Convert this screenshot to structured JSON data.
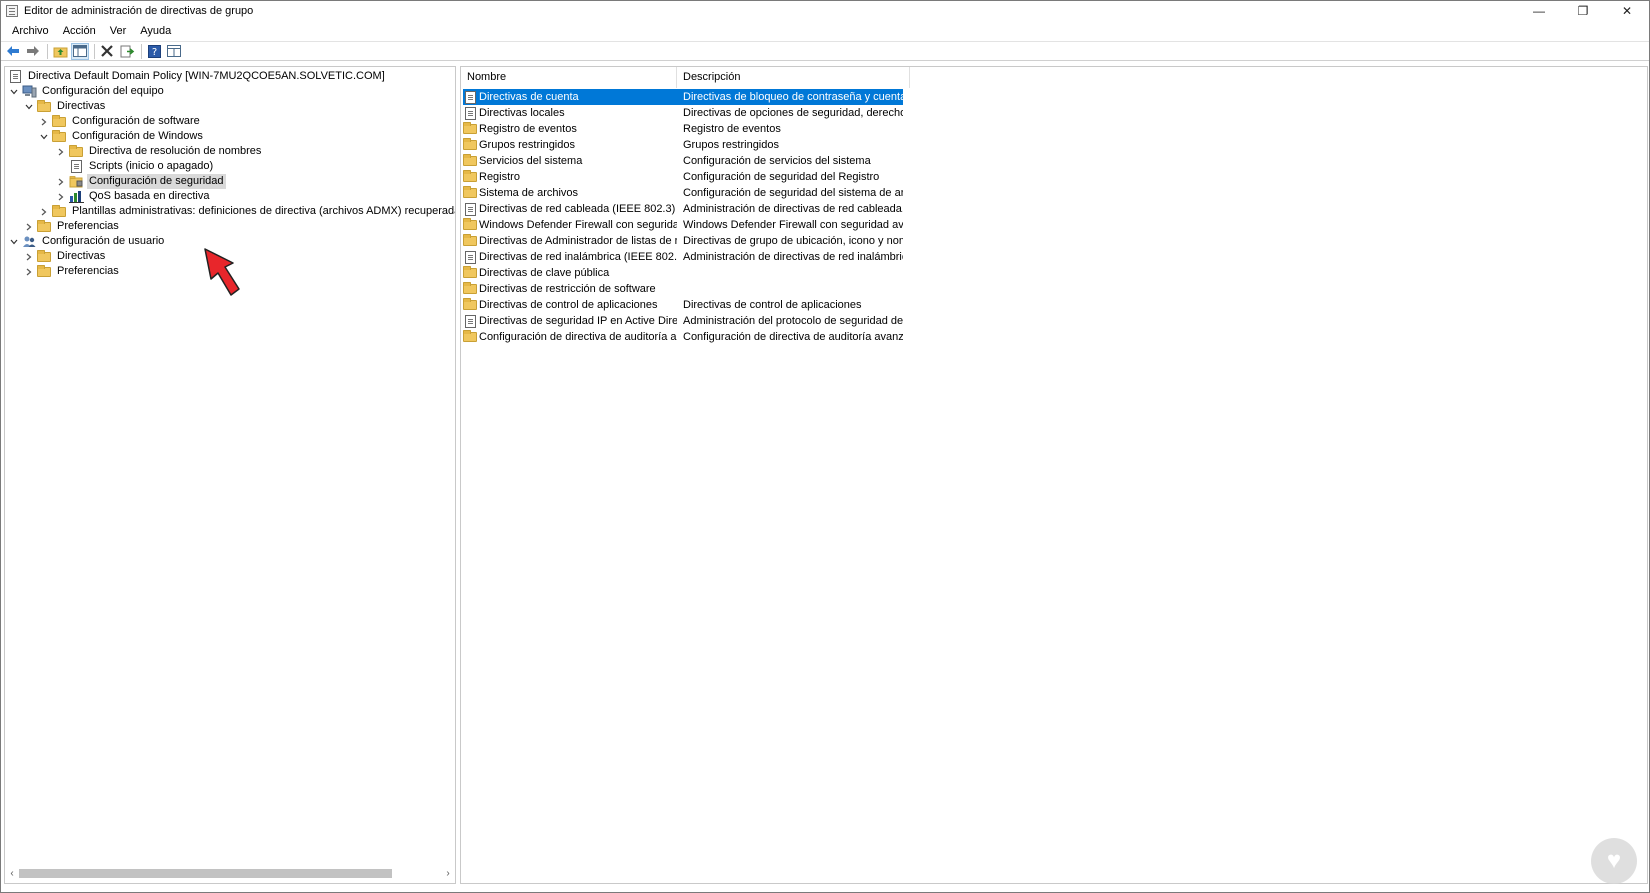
{
  "window": {
    "title": "Editor de administración de directivas de grupo",
    "controls": {
      "minimize": "—",
      "restore": "❐",
      "close": "✕"
    }
  },
  "menu": [
    "Archivo",
    "Acción",
    "Ver",
    "Ayuda"
  ],
  "toolbar": [
    "back-icon",
    "forward-icon",
    "up-folder-icon",
    "show-tree-icon",
    "delete-icon",
    "export-icon",
    "help-icon",
    "view-icon"
  ],
  "tree": {
    "root": "Directiva Default Domain Policy [WIN-7MU2QCOE5AN.SOLVETIC.COM]",
    "items": [
      {
        "label": "Configuración del equipo",
        "expander": "v"
      },
      {
        "label": "Directivas",
        "expander": "v"
      },
      {
        "label": "Configuración de software",
        "expander": ">"
      },
      {
        "label": "Configuración de Windows",
        "expander": "v"
      },
      {
        "label": "Directiva de resolución de nombres",
        "expander": ">"
      },
      {
        "label": "Scripts (inicio o apagado)",
        "expander": ""
      },
      {
        "label": "Configuración de seguridad",
        "expander": ">"
      },
      {
        "label": "QoS basada en directiva",
        "expander": ">"
      },
      {
        "label": "Plantillas administrativas: definiciones de directiva (archivos ADMX) recuperadas del",
        "expander": ">"
      },
      {
        "label": "Preferencias",
        "expander": ">"
      },
      {
        "label": "Configuración de usuario",
        "expander": "v"
      },
      {
        "label": "Directivas",
        "expander": ">"
      },
      {
        "label": "Preferencias",
        "expander": ">"
      }
    ]
  },
  "list": {
    "columns": [
      "Nombre",
      "Descripción"
    ],
    "rows": [
      {
        "name": "Directivas de cuenta",
        "desc": "Directivas de bloqueo de contraseña y cuenta"
      },
      {
        "name": "Directivas locales",
        "desc": "Directivas de opciones de seguridad, derechos ..."
      },
      {
        "name": "Registro de eventos",
        "desc": "Registro de eventos"
      },
      {
        "name": "Grupos restringidos",
        "desc": "Grupos restringidos"
      },
      {
        "name": "Servicios del sistema",
        "desc": "Configuración de servicios del sistema"
      },
      {
        "name": "Registro",
        "desc": "Configuración de seguridad del Registro"
      },
      {
        "name": "Sistema de archivos",
        "desc": "Configuración de seguridad del sistema de arc..."
      },
      {
        "name": "Directivas de red cableada (IEEE 802.3)",
        "desc": "Administración de directivas de red cableada. ..."
      },
      {
        "name": "Windows Defender Firewall con segurida...",
        "desc": "Windows Defender Firewall con seguridad avan..."
      },
      {
        "name": "Directivas de Administrador de listas de r...",
        "desc": "Directivas de grupo de ubicación, icono y nom..."
      },
      {
        "name": "Directivas de red inalámbrica (IEEE 802.11)",
        "desc": "Administración de directivas de red inalámbric..."
      },
      {
        "name": "Directivas de clave pública",
        "desc": ""
      },
      {
        "name": "Directivas de restricción de software",
        "desc": ""
      },
      {
        "name": "Directivas de control de aplicaciones",
        "desc": "Directivas de control de aplicaciones"
      },
      {
        "name": "Directivas de seguridad IP en Active Direc...",
        "desc": "Administración del protocolo de seguridad de I..."
      },
      {
        "name": "Configuración de directiva de auditoría a...",
        "desc": "Configuración de directiva de auditoría avanzada"
      }
    ]
  },
  "colors": {
    "selection": "#0078d7",
    "tree_selection": "#d9d9d9",
    "pointer": "#e8262b"
  }
}
